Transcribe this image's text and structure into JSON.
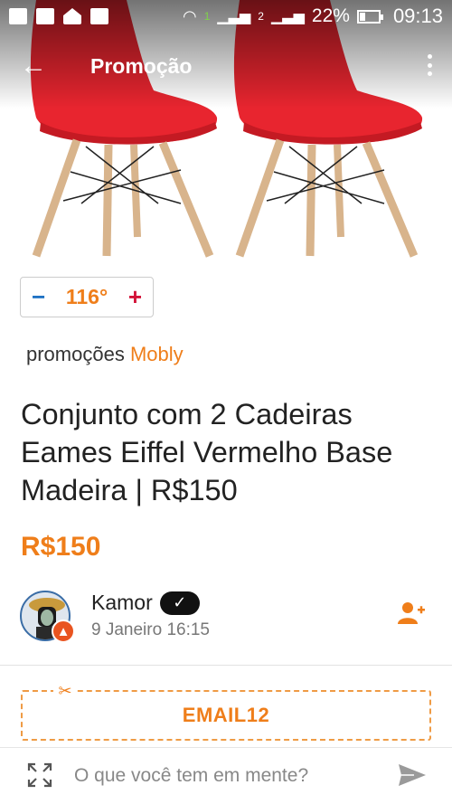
{
  "status_bar": {
    "battery": "22%",
    "time": "09:13",
    "sim_one": "1",
    "sim_two": "2",
    "notification_icons": [
      "message-icon",
      "facebook-icon",
      "home-icon",
      "mail-icon"
    ]
  },
  "app_bar": {
    "title": "Promoção",
    "back_icon": "arrow-left-icon",
    "menu_icon": "more-vertical-icon"
  },
  "deal": {
    "temperature": "116°",
    "minus": "−",
    "plus": "+",
    "merchant_prefix": "promoções",
    "merchant_name": "Mobly",
    "title": "Conjunto com 2 Cadeiras Eames Eiffel Vermelho Base Madeira | R$150",
    "price": "R$150",
    "coupon_code": "EMAIL12"
  },
  "author": {
    "name": "Kamor",
    "verified_mark": "✓",
    "date": "9 Janeiro 16:15",
    "badge_icon": "fire-icon",
    "follow_icon": "add-user-icon"
  },
  "composer": {
    "placeholder": "O que você tem em mente?",
    "expand_icon": "expand-icon",
    "send_icon": "send-icon"
  },
  "colors": {
    "accent": "#ef7e1a",
    "minus": "#1e72c4",
    "plus": "#d31238",
    "chair_seat": "#e8252f",
    "chair_legs": "#d8b48c"
  }
}
